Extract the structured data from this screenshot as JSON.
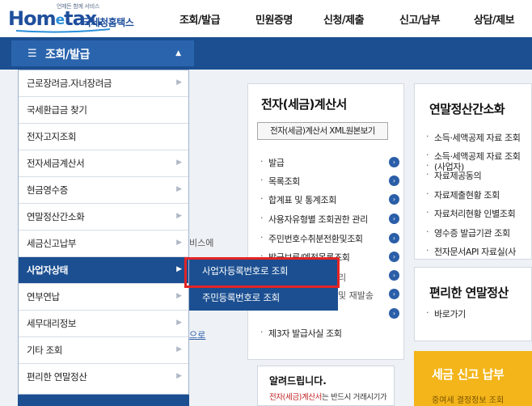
{
  "header": {
    "logo": {
      "brand": "Hom",
      "brand_e": "e",
      "brand_rest": "tax.",
      "korean": "국세청홈택스",
      "tagline": "언제든 함께 서비스"
    },
    "nav": [
      "조회/발급",
      "민원증명",
      "신청/제출",
      "신고/납부",
      "상담/제보"
    ]
  },
  "menu_toggle": {
    "label": "조회/발급"
  },
  "side_menu": {
    "items": [
      "근로장려금.자녀장려금",
      "국세환급금 찾기",
      "전자고지조회",
      "전자세금계산서",
      "현금영수증",
      "연말정산간소화",
      "세금신고납부",
      "사업자상태",
      "연부연납",
      "세무대리정보",
      "기타 조회",
      "편리한 연말정산"
    ],
    "active_index": 7
  },
  "submenu": {
    "items": [
      "사업자등록번호로 조회",
      "주민등록번호로 조회"
    ]
  },
  "obscured": {
    "text1": "비스에",
    "text2": "로",
    "text3": "으로",
    "text4": "및 재발송",
    "text5": "리"
  },
  "panel_invoice": {
    "title": "전자(세금)계산서",
    "xml_button": "전자(세금)계산서 XML원본보기",
    "items": [
      "발급",
      "목록조회",
      "합계표 및 통계조회",
      "사용자유형별 조회권한 관리",
      "주민번호수취분전환및조회",
      "발급보류/예정목록조회",
      "",
      "",
      "제3자 발급사실 조회"
    ]
  },
  "panel_yearend": {
    "title": "연말정산간소화",
    "items": [
      "소득·세액공제 자료 조회",
      "소득·세액공제 자료 조회",
      "(사업자)",
      "자료제공동의",
      "자료제출현황 조회",
      "자료처리현황 인별조회",
      "영수증 발급기관 조회",
      "전자문서API 자료실(사"
    ]
  },
  "panel_convenient": {
    "title": "편리한 연말정산",
    "items": [
      "바로가기"
    ]
  },
  "notice": {
    "title": "알려드립니다.",
    "text_highlight": "전자(세금)계산서",
    "text_rest": "는 반드시 거래시기가"
  },
  "tax_banner": {
    "title": "세금 신고 납부",
    "text": "중여세 결정정보 조회"
  },
  "colors": {
    "primary": "#1b4f91",
    "accent": "#2a64ad",
    "highlight": "#e32424",
    "banner": "#f3b51a"
  }
}
